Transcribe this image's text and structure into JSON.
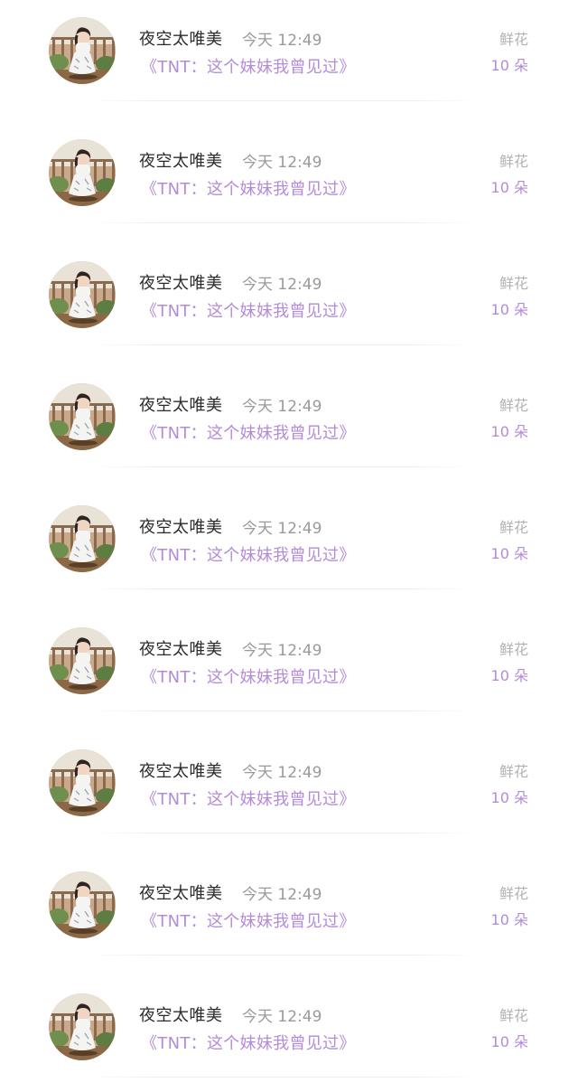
{
  "comments": [
    {
      "username": "夜空太唯美",
      "time": "今天 12:49",
      "title": "《TNT：这个妹妹我曾见过》",
      "gift_name": "鲜花",
      "gift_count": "10 朵"
    },
    {
      "username": "夜空太唯美",
      "time": "今天 12:49",
      "title": "《TNT：这个妹妹我曾见过》",
      "gift_name": "鲜花",
      "gift_count": "10 朵"
    },
    {
      "username": "夜空太唯美",
      "time": "今天 12:49",
      "title": "《TNT：这个妹妹我曾见过》",
      "gift_name": "鲜花",
      "gift_count": "10 朵"
    },
    {
      "username": "夜空太唯美",
      "time": "今天 12:49",
      "title": "《TNT：这个妹妹我曾见过》",
      "gift_name": "鲜花",
      "gift_count": "10 朵"
    },
    {
      "username": "夜空太唯美",
      "time": "今天 12:49",
      "title": "《TNT：这个妹妹我曾见过》",
      "gift_name": "鲜花",
      "gift_count": "10 朵"
    },
    {
      "username": "夜空太唯美",
      "time": "今天 12:49",
      "title": "《TNT：这个妹妹我曾见过》",
      "gift_name": "鲜花",
      "gift_count": "10 朵"
    },
    {
      "username": "夜空太唯美",
      "time": "今天 12:49",
      "title": "《TNT：这个妹妹我曾见过》",
      "gift_name": "鲜花",
      "gift_count": "10 朵"
    },
    {
      "username": "夜空太唯美",
      "time": "今天 12:49",
      "title": "《TNT：这个妹妹我曾见过》",
      "gift_name": "鲜花",
      "gift_count": "10 朵"
    },
    {
      "username": "夜空太唯美",
      "time": "今天 12:49",
      "title": "《TNT：这个妹妹我曾见过》",
      "gift_name": "鲜花",
      "gift_count": "10 朵"
    }
  ],
  "colors": {
    "accent": "#b38bd9",
    "username": "#2b2b2b",
    "muted": "#9a9a9a",
    "background": "#ffffff"
  },
  "icons": {
    "avatar": "user-avatar-photo"
  }
}
